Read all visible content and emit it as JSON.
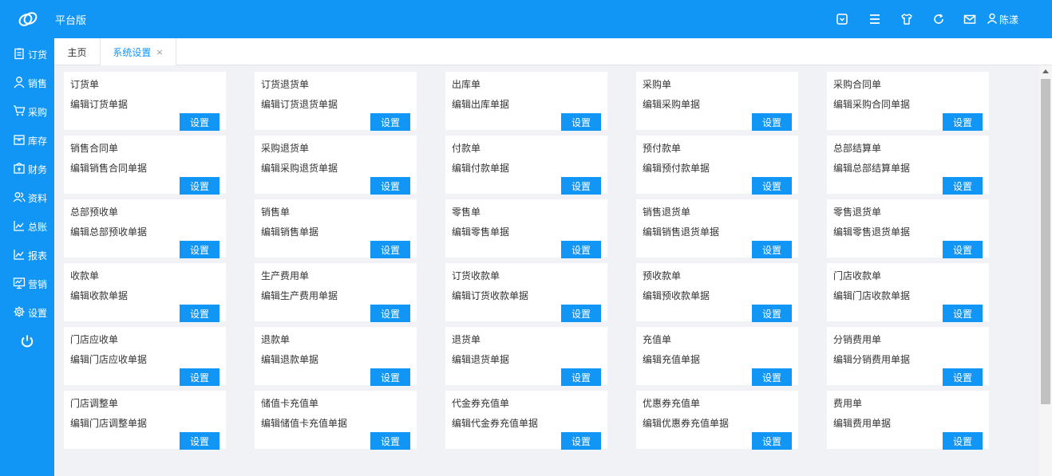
{
  "header": {
    "app_title": "平台版",
    "user_name": "陈漾",
    "icons": [
      "dropdown-box-icon",
      "menu-icon",
      "shirt-icon",
      "refresh-icon",
      "mail-icon",
      "user-icon"
    ]
  },
  "sidebar": {
    "items": [
      {
        "label": "订货",
        "icon": "clipboard-icon"
      },
      {
        "label": "销售",
        "icon": "user-icon"
      },
      {
        "label": "采购",
        "icon": "cart-icon"
      },
      {
        "label": "库存",
        "icon": "box-icon"
      },
      {
        "label": "财务",
        "icon": "wallet-icon"
      },
      {
        "label": "资料",
        "icon": "users-icon"
      },
      {
        "label": "总账",
        "icon": "chart-icon"
      },
      {
        "label": "报表",
        "icon": "chart-icon"
      },
      {
        "label": "营销",
        "icon": "monitor-icon"
      },
      {
        "label": "设置",
        "icon": "gear-icon"
      }
    ],
    "power_icon": "power-icon"
  },
  "tabs": {
    "home": "主页",
    "active": "系统设置",
    "close": "×"
  },
  "cards": [
    {
      "title": "订货单",
      "desc": "编辑订货单据",
      "button": "设置"
    },
    {
      "title": "订货退货单",
      "desc": "编辑订货退货单据",
      "button": "设置"
    },
    {
      "title": "出库单",
      "desc": "编辑出库单据",
      "button": "设置"
    },
    {
      "title": "采购单",
      "desc": "编辑采购单据",
      "button": "设置"
    },
    {
      "title": "采购合同单",
      "desc": "编辑采购合同单据",
      "button": "设置"
    },
    {
      "title": "销售合同单",
      "desc": "编辑销售合同单据",
      "button": "设置"
    },
    {
      "title": "采购退货单",
      "desc": "编辑采购退货单据",
      "button": "设置"
    },
    {
      "title": "付款单",
      "desc": "编辑付款单据",
      "button": "设置"
    },
    {
      "title": "预付款单",
      "desc": "编辑预付款单据",
      "button": "设置"
    },
    {
      "title": "总部结算单",
      "desc": "编辑总部结算单据",
      "button": "设置"
    },
    {
      "title": "总部预收单",
      "desc": "编辑总部预收单据",
      "button": "设置"
    },
    {
      "title": "销售单",
      "desc": "编辑销售单据",
      "button": "设置"
    },
    {
      "title": "零售单",
      "desc": "编辑零售单据",
      "button": "设置"
    },
    {
      "title": "销售退货单",
      "desc": "编辑销售退货单据",
      "button": "设置"
    },
    {
      "title": "零售退货单",
      "desc": "编辑零售退货单据",
      "button": "设置"
    },
    {
      "title": "收款单",
      "desc": "编辑收款单据",
      "button": "设置"
    },
    {
      "title": "生产费用单",
      "desc": "编辑生产费用单据",
      "button": "设置"
    },
    {
      "title": "订货收款单",
      "desc": "编辑订货收款单据",
      "button": "设置"
    },
    {
      "title": "预收款单",
      "desc": "编辑预收款单据",
      "button": "设置"
    },
    {
      "title": "门店收款单",
      "desc": "编辑门店收款单据",
      "button": "设置"
    },
    {
      "title": "门店应收单",
      "desc": "编辑门店应收单据",
      "button": "设置"
    },
    {
      "title": "退款单",
      "desc": "编辑退款单据",
      "button": "设置"
    },
    {
      "title": "退货单",
      "desc": "编辑退货单据",
      "button": "设置"
    },
    {
      "title": "充值单",
      "desc": "编辑充值单据",
      "button": "设置"
    },
    {
      "title": "分销费用单",
      "desc": "编辑分销费用单据",
      "button": "设置"
    },
    {
      "title": "门店调整单",
      "desc": "编辑门店调整单据",
      "button": "设置"
    },
    {
      "title": "储值卡充值单",
      "desc": "编辑储值卡充值单据",
      "button": "设置"
    },
    {
      "title": "代金券充值单",
      "desc": "编辑代金券充值单据",
      "button": "设置"
    },
    {
      "title": "优惠券充值单",
      "desc": "编辑优惠券充值单据",
      "button": "设置"
    },
    {
      "title": "费用单",
      "desc": "编辑费用单据",
      "button": "设置"
    }
  ],
  "colors": {
    "primary": "#1296f6",
    "background": "#f0f2f5"
  }
}
